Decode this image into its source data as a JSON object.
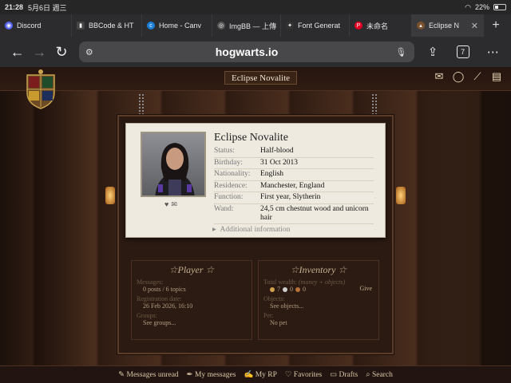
{
  "status_bar": {
    "time": "21:28",
    "date": "5月6日 週三",
    "battery": "22%"
  },
  "tabs": [
    {
      "label": "Discord",
      "icon": "discord-icon",
      "color": "#5865f2"
    },
    {
      "label": "BBCode & HT",
      "icon": "code-icon",
      "color": "#444444"
    },
    {
      "label": "Home - Canv",
      "icon": "canva-icon",
      "color": "#1a7fd6"
    },
    {
      "label": "ImgBB — 上傳",
      "icon": "imgbb-icon",
      "color": "#555555"
    },
    {
      "label": "Font Generat",
      "icon": "sparkle-icon",
      "color": "#333333"
    },
    {
      "label": "未命名",
      "icon": "pinterest-icon",
      "color": "#e60023"
    },
    {
      "label": "Eclipse N",
      "icon": "site-icon",
      "color": "#7a5230",
      "active": true
    }
  ],
  "toolbar": {
    "url": "hogwarts.io"
  },
  "page": {
    "username": "Eclipse Novalite",
    "profile": {
      "name": "Eclipse Novalite",
      "fields": [
        {
          "key": "Status:",
          "value": "Half-blood"
        },
        {
          "key": "Birthday:",
          "value": "31 Oct 2013"
        },
        {
          "key": "Nationality:",
          "value": "English"
        },
        {
          "key": "Residence:",
          "value": "Manchester, England"
        },
        {
          "key": "Function:",
          "value": "First year, Slytherin"
        },
        {
          "key": "Wand:",
          "value": "24,5 cm chestnut wood and unicorn hair"
        }
      ],
      "additional": "Additional information"
    },
    "player": {
      "title": "Player",
      "messages_label": "Messages:",
      "messages_value": "0 posts / 6 topics",
      "registration_label": "Registration date:",
      "registration_value": "26 Feb 2026, 16:10",
      "groups_label": "Groups:",
      "groups_value": "See groups..."
    },
    "inventory": {
      "title": "Inventory",
      "wealth_label": "Total wealth:",
      "wealth_note": "(money + objects)",
      "give_label": "Give",
      "coins": [
        {
          "amount": "7",
          "color": "#d4a24a"
        },
        {
          "amount": "0",
          "color": "#cfcfcf"
        },
        {
          "amount": "0",
          "color": "#b8733a"
        }
      ],
      "objects_label": "Objects:",
      "objects_value": "See objects...",
      "pet_label": "Pet:",
      "pet_value": "No pet"
    },
    "bottom_nav": [
      {
        "label": "Messages unread",
        "icon": "messages-icon"
      },
      {
        "label": "My messages",
        "icon": "feather-icon"
      },
      {
        "label": "My RP",
        "icon": "quill-icon"
      },
      {
        "label": "Favorites",
        "icon": "heart-icon"
      },
      {
        "label": "Drafts",
        "icon": "drafts-icon"
      },
      {
        "label": "Search",
        "icon": "search-icon"
      }
    ]
  }
}
